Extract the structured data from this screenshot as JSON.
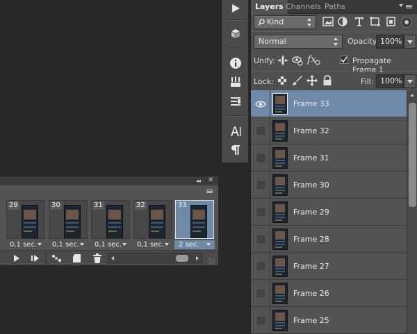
{
  "toolstrip": {
    "icons": [
      "play-icon",
      "3d-icon",
      "info-icon",
      "brush-presets-icon",
      "properties-icon",
      "character-icon",
      "paragraph-icon"
    ]
  },
  "layers_panel": {
    "tabs": [
      {
        "label": "Layers",
        "active": true
      },
      {
        "label": "Channels",
        "active": false
      },
      {
        "label": "Paths",
        "active": false
      }
    ],
    "filter_kind": "Kind",
    "blend_mode": "Normal",
    "opacity_label": "Opacity:",
    "opacity_value": "100%",
    "unify_label": "Unify:",
    "propagate_label": "Propagate Frame 1",
    "propagate_checked": true,
    "lock_label": "Lock:",
    "fill_label": "Fill:",
    "fill_value": "100%",
    "layers": [
      {
        "name": "Frame 33",
        "visible": true,
        "selected": true
      },
      {
        "name": "Frame 32",
        "visible": false,
        "selected": false
      },
      {
        "name": "Frame 31",
        "visible": false,
        "selected": false
      },
      {
        "name": "Frame 30",
        "visible": false,
        "selected": false
      },
      {
        "name": "Frame 29",
        "visible": false,
        "selected": false
      },
      {
        "name": "Frame 28",
        "visible": false,
        "selected": false
      },
      {
        "name": "Frame 27",
        "visible": false,
        "selected": false
      },
      {
        "name": "Frame 26",
        "visible": false,
        "selected": false
      },
      {
        "name": "Frame 25",
        "visible": false,
        "selected": false
      }
    ]
  },
  "timeline": {
    "frames": [
      {
        "number": "29",
        "delay": "0,1 sec.",
        "selected": false
      },
      {
        "number": "30",
        "delay": "0,1 sec.",
        "selected": false
      },
      {
        "number": "31",
        "delay": "0,1 sec.",
        "selected": false
      },
      {
        "number": "32",
        "delay": "0,1 sec.",
        "selected": false
      },
      {
        "number": "33",
        "delay": "2 sec.",
        "selected": true
      }
    ]
  },
  "colors": {
    "panel_bg": "#4f4f4f",
    "selection": "#6f8aa8",
    "app_bg": "#282828"
  }
}
